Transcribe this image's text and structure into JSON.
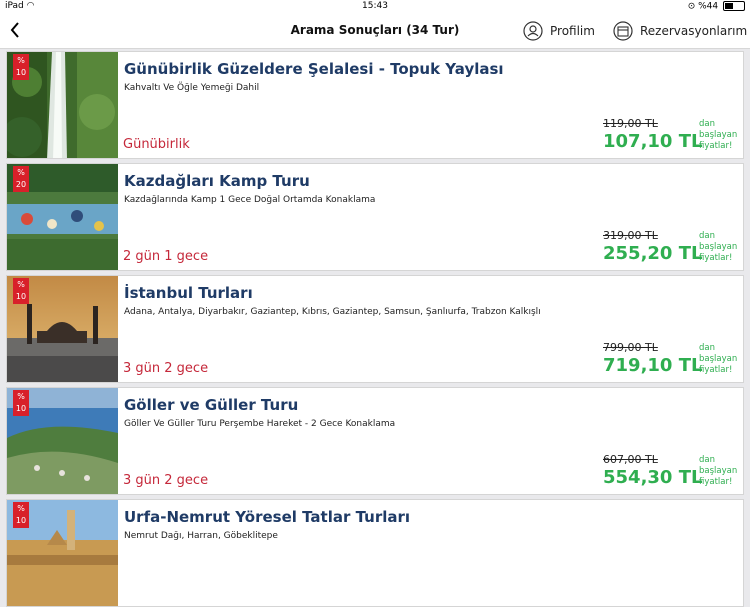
{
  "status_bar": {
    "device": "iPad",
    "time": "15:43",
    "battery": "%44",
    "battery_level": 0.44
  },
  "nav": {
    "title": "Arama Sonuçları (34 Tur)",
    "profile_label": "Profilim",
    "reservations_label": "Rezervasyonlarım"
  },
  "price_suffix": "dan başlayan fiyatlar!",
  "tours": [
    {
      "badge": "%\n10",
      "title": "Günübirlik Güzeldere Şelalesi - Topuk Yaylası",
      "description": "Kahvaltı Ve Öğle Yemeği Dahil",
      "duration": "Günübirlik",
      "old_price": "119,00 TL",
      "new_price": "107,10 TL"
    },
    {
      "badge": "%\n20",
      "title": "Kazdağları Kamp Turu",
      "description": "Kazdağlarında Kamp 1 Gece Doğal Ortamda Konaklama",
      "duration": "2 gün 1 gece",
      "old_price": "319,00 TL",
      "new_price": "255,20 TL"
    },
    {
      "badge": "%\n10",
      "title": "İstanbul Turları",
      "description": "Adana, Antalya, Diyarbakır, Gaziantep, Kıbrıs, Gaziantep, Samsun, Şanlıurfa, Trabzon Kalkışlı",
      "duration": "3 gün 2 gece",
      "old_price": "799,00 TL",
      "new_price": "719,10 TL"
    },
    {
      "badge": "%\n10",
      "title": "Göller ve Güller Turu",
      "description": "Göller Ve Güller Turu Perşembe Hareket - 2 Gece Konaklama",
      "duration": "3 gün 2 gece",
      "old_price": "607,00 TL",
      "new_price": "554,30 TL"
    },
    {
      "badge": "%\n10",
      "title": "Urfa-Nemrut Yöresel Tatlar Turları",
      "description": "Nemrut Dağı, Harran, Göbeklitepe",
      "duration": "",
      "old_price": "",
      "new_price": ""
    }
  ]
}
